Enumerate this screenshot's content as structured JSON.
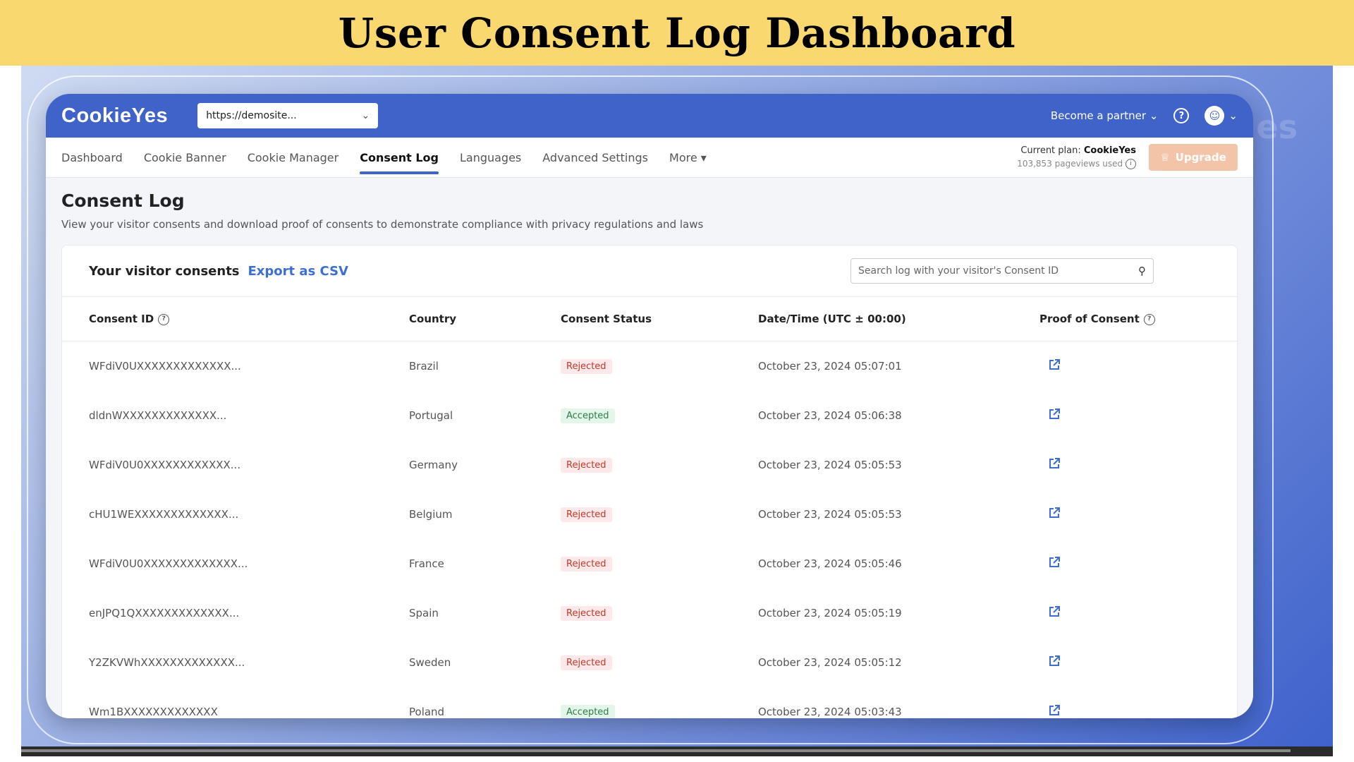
{
  "banner": {
    "title": "User Consent Log Dashboard"
  },
  "watermark": "es",
  "topbar": {
    "logo": "CookieYes",
    "site_selector": "https://demosite...",
    "partner_link": "Become a partner"
  },
  "nav": {
    "tabs": [
      {
        "label": "Dashboard"
      },
      {
        "label": "Cookie Banner"
      },
      {
        "label": "Cookie Manager"
      },
      {
        "label": "Consent Log"
      },
      {
        "label": "Languages"
      },
      {
        "label": "Advanced Settings"
      },
      {
        "label": "More"
      }
    ],
    "active_tab": "Consent Log",
    "plan_label": "Current plan:",
    "plan_name": "CookieYes",
    "pageviews": "103,853 pageviews used",
    "upgrade_label": "Upgrade"
  },
  "page": {
    "title": "Consent Log",
    "subtitle": "View your visitor consents and download proof of consents to demonstrate compliance with privacy regulations and laws"
  },
  "card": {
    "heading": "Your visitor consents",
    "export_label": "Export as CSV",
    "search_placeholder": "Search log with your visitor's Consent ID"
  },
  "table": {
    "headers": [
      "Consent ID",
      "Country",
      "Consent Status",
      "Date/Time (UTC ± 00:00)",
      "Proof of Consent"
    ],
    "rows": [
      {
        "id": "WFdiV0UXXXXXXXXXXXXX...",
        "country": "Brazil",
        "status": "Rejected",
        "datetime": "October 23, 2024 05:07:01"
      },
      {
        "id": "dldnWXXXXXXXXXXXXX...",
        "country": "Portugal",
        "status": "Accepted",
        "datetime": "October 23, 2024 05:06:38"
      },
      {
        "id": "WFdiV0U0XXXXXXXXXXXX...",
        "country": "Germany",
        "status": "Rejected",
        "datetime": "October 23, 2024 05:05:53"
      },
      {
        "id": "cHU1WEXXXXXXXXXXXXX...",
        "country": "Belgium",
        "status": "Rejected",
        "datetime": "October 23, 2024 05:05:53"
      },
      {
        "id": "WFdiV0U0XXXXXXXXXXXXX...",
        "country": "France",
        "status": "Rejected",
        "datetime": "October 23, 2024 05:05:46"
      },
      {
        "id": "enJPQ1QXXXXXXXXXXXXX...",
        "country": "Spain",
        "status": "Rejected",
        "datetime": "October 23, 2024 05:05:19"
      },
      {
        "id": "Y2ZKVWhXXXXXXXXXXXXX...",
        "country": "Sweden",
        "status": "Rejected",
        "datetime": "October 23, 2024 05:05:12"
      },
      {
        "id": "Wm1BXXXXXXXXXXXXX",
        "country": "Poland",
        "status": "Accepted",
        "datetime": "October 23, 2024 05:03:43"
      }
    ]
  },
  "colors": {
    "banner_bg": "#f9d86f",
    "brand_blue": "#3f63c9",
    "link_blue": "#3d6fd0",
    "rejected_bg": "#fde9e9",
    "rejected_text": "#c0392b",
    "accepted_bg": "#e4f5ea",
    "accepted_text": "#2e7d4a",
    "upgrade_bg": "#f3c4a8"
  },
  "icons": [
    "help-icon",
    "avatar-icon",
    "chevron-down-icon",
    "info-icon",
    "crown-icon",
    "search-icon",
    "question-icon",
    "external-link-icon"
  ]
}
